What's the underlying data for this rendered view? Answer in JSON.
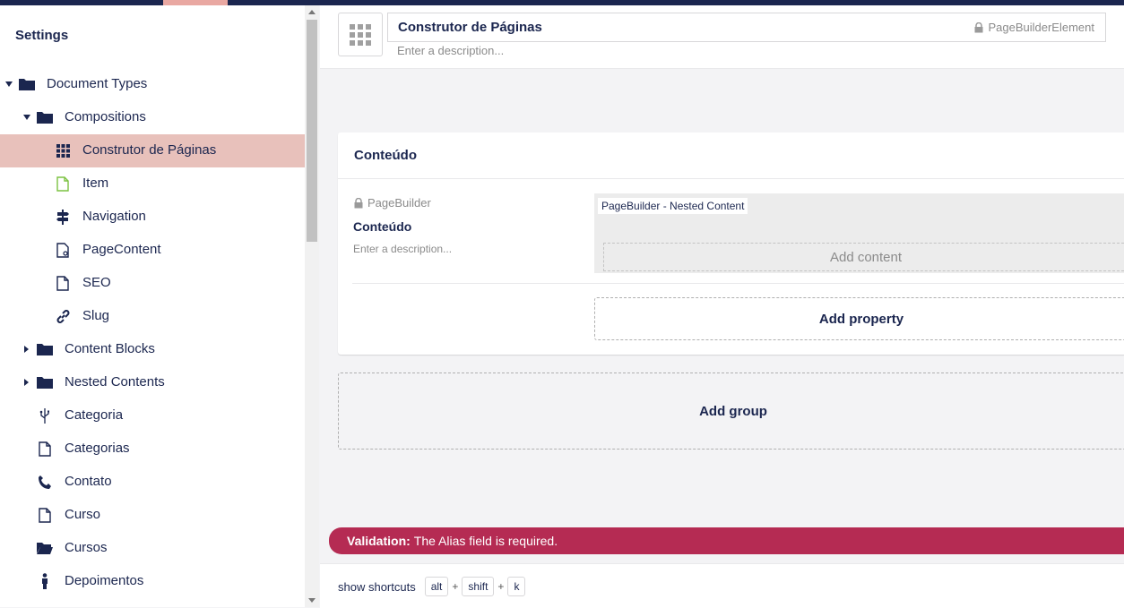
{
  "sidebar": {
    "title": "Settings",
    "items": [
      {
        "label": "Document Types",
        "icon": "folder-icon",
        "caret": "down",
        "level": 0
      },
      {
        "label": "Compositions",
        "icon": "folder-icon",
        "caret": "down",
        "level": 1
      },
      {
        "label": "Construtor de Páginas",
        "icon": "grid-icon",
        "caret": "",
        "level": 2,
        "active": true
      },
      {
        "label": "Item",
        "icon": "document-icon",
        "caret": "",
        "level": 2,
        "icon_color": "#7cc242"
      },
      {
        "label": "Navigation",
        "icon": "signpost-icon",
        "caret": "",
        "level": 2
      },
      {
        "label": "PageContent",
        "icon": "document-settings-icon",
        "caret": "",
        "level": 2
      },
      {
        "label": "SEO",
        "icon": "document-icon",
        "caret": "",
        "level": 2
      },
      {
        "label": "Slug",
        "icon": "link-icon",
        "caret": "",
        "level": 2
      },
      {
        "label": "Content Blocks",
        "icon": "folder-icon",
        "caret": "right",
        "level": 1
      },
      {
        "label": "Nested Contents",
        "icon": "folder-icon",
        "caret": "right",
        "level": 1
      },
      {
        "label": "Categoria",
        "icon": "usb-icon",
        "caret": "",
        "level": 1
      },
      {
        "label": "Categorias",
        "icon": "document-icon",
        "caret": "",
        "level": 1
      },
      {
        "label": "Contato",
        "icon": "phone-icon",
        "caret": "",
        "level": 1
      },
      {
        "label": "Curso",
        "icon": "document-icon",
        "caret": "",
        "level": 1
      },
      {
        "label": "Cursos",
        "icon": "folder-open-icon",
        "caret": "",
        "level": 1
      },
      {
        "label": "Depoimentos",
        "icon": "person-icon",
        "caret": "",
        "level": 1
      }
    ]
  },
  "header": {
    "name": "Construtor de Páginas",
    "alias": "PageBuilderElement",
    "description_placeholder": "Enter a description..."
  },
  "group": {
    "title": "Conteúdo",
    "property": {
      "alias": "PageBuilder",
      "name": "Conteúdo",
      "description_placeholder": "Enter a description...",
      "editor_tag": "PageBuilder - Nested Content",
      "add_content_label": "Add content"
    },
    "add_property_label": "Add property"
  },
  "add_group_label": "Add group",
  "validation": {
    "label": "Validation:",
    "message": "The Alias field is required."
  },
  "footer": {
    "shortcuts_label": "show shortcuts",
    "keys": [
      "alt",
      "shift",
      "k"
    ],
    "plus": "+"
  },
  "colors": {
    "brand": "#1b264f",
    "active_row": "#e8c1bb",
    "validation": "#b52b53",
    "item_icon": "#7cc242"
  }
}
